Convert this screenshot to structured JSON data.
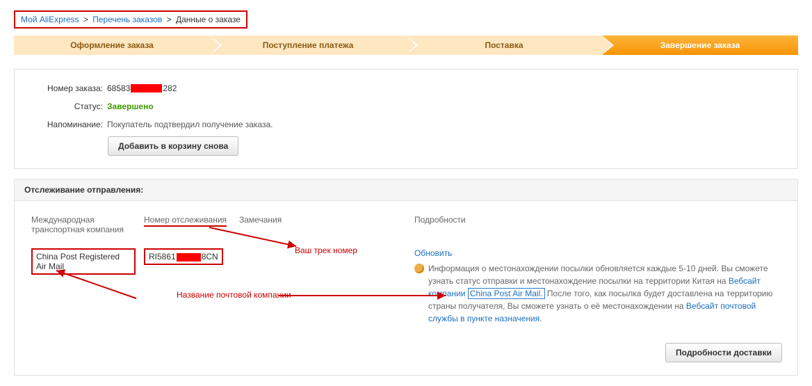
{
  "breadcrumb": {
    "home": "Мой AliExpress",
    "list": "Перечень заказов",
    "current": "Данные о заказе"
  },
  "steps": {
    "s1": "Оформление заказа",
    "s2": "Поступление платежа",
    "s3": "Поставка",
    "s4": "Завершение заказа"
  },
  "order": {
    "number_label": "Номер заказа:",
    "number_prefix": "68583",
    "number_suffix": "282",
    "status_label": "Статус:",
    "status_value": "Завершено",
    "reminder_label": "Напоминание:",
    "reminder_value": "Покупатель подтвердил получение заказа.",
    "add_again": "Добавить в корзину снова"
  },
  "tracking": {
    "heading": "Отслеживание отправления:",
    "col_company": "Международная транспортная компания",
    "col_trackno": "Номер отслеживания",
    "col_notes": "Замечания",
    "col_details": "Подробности",
    "company_value": "China Post Registered Air Mail",
    "trackno_prefix": "RI5861",
    "trackno_suffix": "8CN",
    "refresh": "Обновить",
    "info_pre": "Информация о местонахождении посылки обновляется каждые 5-10 дней. Вы сможете узнать статус отправки и местонахождение посылки на территории Китая на ",
    "info_link1a": "Вебсайт компании ",
    "info_link1b": "China Post Air Mail.",
    "info_mid": " После того, как посылка будет доставлена на территорию страны получателя, Вы сможете узнать о её местонахождении на ",
    "info_link2": "Вебсайт почтовой службы в пункте назначения",
    "period": ".",
    "details_btn": "Подробности доставки"
  },
  "annotations": {
    "your_track": "Ваш трек номер",
    "company_name": "Название почтовой компании"
  }
}
